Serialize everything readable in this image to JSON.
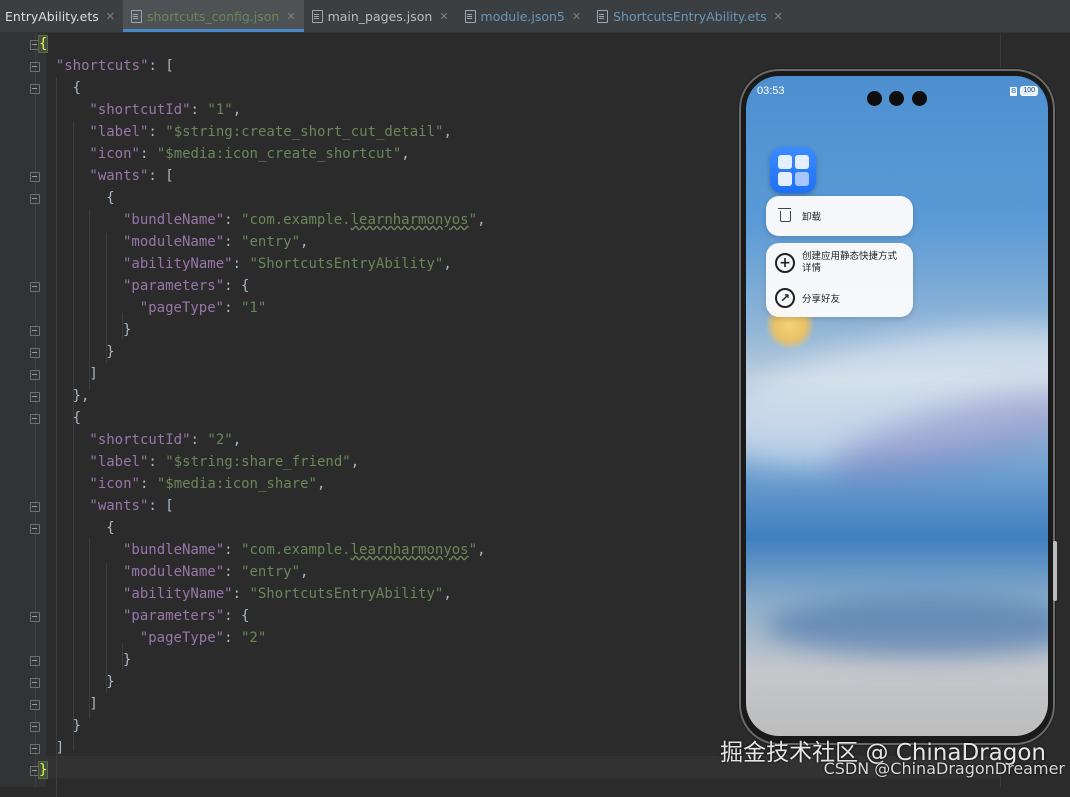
{
  "tabs": [
    {
      "label": "EntryAbility.ets"
    },
    {
      "label": "shortcuts_config.json"
    },
    {
      "label": "main_pages.json"
    },
    {
      "label": "module.json5"
    },
    {
      "label": "ShortcutsEntryAbility.ets"
    }
  ],
  "code_lines": [
    "{",
    "\"shortcuts\": [",
    "{",
    "\"shortcutId\": \"1\",",
    "\"label\": \"$string:create_short_cut_detail\",",
    "\"icon\": \"$media:icon_create_shortcut\",",
    "\"wants\": [",
    "{",
    "\"bundleName\": \"com.example.learnharmonyos\",",
    "\"moduleName\": \"entry\",",
    "\"abilityName\": \"ShortcutsEntryAbility\",",
    "\"parameters\": {",
    "\"pageType\": \"1\"",
    "}",
    "}",
    "]",
    "},",
    "{",
    "\"shortcutId\": \"2\",",
    "\"label\": \"$string:share_friend\",",
    "\"icon\": \"$media:icon_share\",",
    "\"wants\": [",
    "{",
    "\"bundleName\": \"com.example.learnharmonyos\",",
    "\"moduleName\": \"entry\",",
    "\"abilityName\": \"ShortcutsEntryAbility\",",
    "\"parameters\": {",
    "\"pageType\": \"2\"",
    "}",
    "}",
    "]",
    "}",
    "]",
    "}"
  ],
  "phone": {
    "time": "03:53",
    "battery": "100",
    "sim": "B",
    "menu_uninstall": "卸载",
    "menu_create_shortcut": "创建应用静态快捷方式详情",
    "menu_share": "分享好友"
  },
  "watermark": {
    "line1": "掘金技术社区 @ ChinaDragon",
    "line2": "CSDN @ChinaDragonDreamer"
  }
}
